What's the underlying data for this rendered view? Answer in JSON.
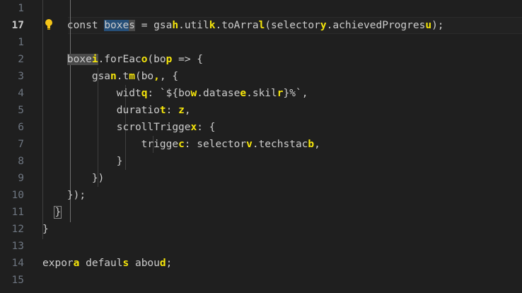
{
  "editor": {
    "line_numbers": [
      "1",
      "17",
      "1",
      "2",
      "3",
      "4",
      "5",
      "6",
      "7",
      "8",
      "9",
      "10",
      "11",
      "12",
      "13",
      "14",
      "15"
    ],
    "active_line_index": 1,
    "lines": [
      [],
      [
        {
          "t": "    const "
        },
        {
          "t": "boxe",
          "c": "hl-sel"
        },
        {
          "t": "s",
          "c": "hl-word"
        },
        {
          "t": " = gsa"
        },
        {
          "t": "h",
          "c": "y"
        },
        {
          "t": ".util"
        },
        {
          "t": "k",
          "c": "y"
        },
        {
          "t": ".toArra"
        },
        {
          "t": "l",
          "c": "y"
        },
        {
          "t": "(selector"
        },
        {
          "t": "y",
          "c": "y"
        },
        {
          "t": ".achievedProgres"
        },
        {
          "t": "u",
          "c": "y"
        },
        {
          "t": ");"
        }
      ],
      [],
      [
        {
          "t": "    "
        },
        {
          "t": "boxe",
          "c": "hl-word"
        },
        {
          "t": "i",
          "c": "y hl-word"
        },
        {
          "t": ".forEac"
        },
        {
          "t": "o",
          "c": "y"
        },
        {
          "t": "(bo"
        },
        {
          "t": "p",
          "c": "y"
        },
        {
          "t": " => {"
        }
      ],
      [
        {
          "t": "        gsa"
        },
        {
          "t": "n",
          "c": "y"
        },
        {
          "t": ".t"
        },
        {
          "t": "m",
          "c": "y"
        },
        {
          "t": "(bo"
        },
        {
          "t": ",",
          "c": "y"
        },
        {
          "t": ", {"
        }
      ],
      [
        {
          "t": "            widt"
        },
        {
          "t": "q",
          "c": "y"
        },
        {
          "t": ": `${bo"
        },
        {
          "t": "w",
          "c": "y"
        },
        {
          "t": ".datase"
        },
        {
          "t": "e",
          "c": "y"
        },
        {
          "t": ".skil"
        },
        {
          "t": "r",
          "c": "y"
        },
        {
          "t": "}%`,"
        }
      ],
      [
        {
          "t": "            duratio"
        },
        {
          "t": "t",
          "c": "y"
        },
        {
          "t": ": "
        },
        {
          "t": "z",
          "c": "y"
        },
        {
          "t": ","
        }
      ],
      [
        {
          "t": "            scrollTrigge"
        },
        {
          "t": "x",
          "c": "y"
        },
        {
          "t": ": {"
        }
      ],
      [
        {
          "t": "                trigge"
        },
        {
          "t": "c",
          "c": "y"
        },
        {
          "t": ": selector"
        },
        {
          "t": "v",
          "c": "y"
        },
        {
          "t": ".techstac"
        },
        {
          "t": "b",
          "c": "y"
        },
        {
          "t": ","
        }
      ],
      [
        {
          "t": "            }"
        }
      ],
      [
        {
          "t": "        })"
        }
      ],
      [
        {
          "t": "    });"
        }
      ],
      [
        {
          "t": "  "
        },
        {
          "t": "}",
          "c": "bracket-box"
        }
      ],
      [
        {
          "t": "}"
        }
      ],
      [],
      [
        {
          "t": "expor"
        },
        {
          "t": "a",
          "c": "y"
        },
        {
          "t": " defaul"
        },
        {
          "t": "s",
          "c": "y"
        },
        {
          "t": " abou"
        },
        {
          "t": "d",
          "c": "y"
        },
        {
          "t": ";"
        }
      ],
      []
    ]
  }
}
